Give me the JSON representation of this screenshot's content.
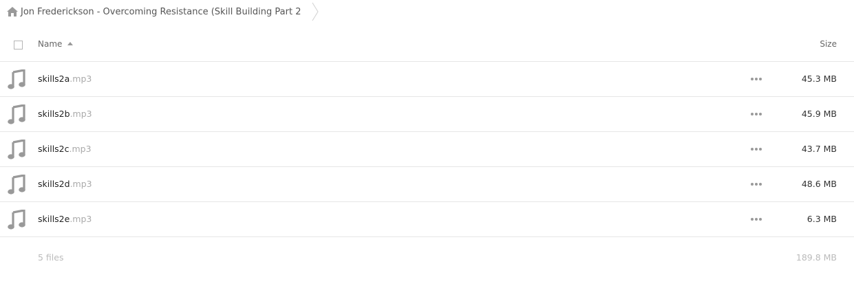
{
  "breadcrumb": {
    "folder": "Jon Frederickson - Overcoming Resistance (Skill Building Part 2"
  },
  "header": {
    "name_label": "Name",
    "size_label": "Size",
    "sort": "ascending"
  },
  "files": [
    {
      "base": "skills2a",
      "ext": ".mp3",
      "size": "45.3 MB",
      "icon": "music-note-icon"
    },
    {
      "base": "skills2b",
      "ext": ".mp3",
      "size": "45.9 MB",
      "icon": "music-note-icon"
    },
    {
      "base": "skills2c",
      "ext": ".mp3",
      "size": "43.7 MB",
      "icon": "music-note-icon"
    },
    {
      "base": "skills2d",
      "ext": ".mp3",
      "size": "48.6 MB",
      "icon": "music-note-icon"
    },
    {
      "base": "skills2e",
      "ext": ".mp3",
      "size": "6.3 MB",
      "icon": "music-note-icon"
    }
  ],
  "footer": {
    "count": "5 files",
    "total": "189.8 MB"
  },
  "colors": {
    "icon_gray": "#999999",
    "divider": "#e6e6e6",
    "muted_text": "#bbbbbb"
  }
}
